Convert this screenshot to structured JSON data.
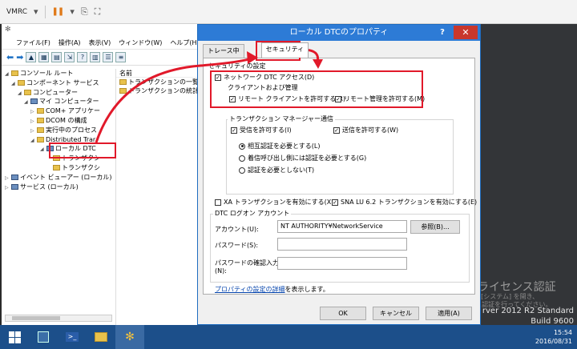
{
  "vmrc": {
    "title": "VMRC"
  },
  "component_services": {
    "menu": [
      "ファイル(F)",
      "操作(A)",
      "表示(V)",
      "ウィンドウ(W)",
      "ヘルプ(H)"
    ],
    "tree": [
      "コンソール ルート",
      "コンポーネント サービス",
      "コンピューター",
      "マイ コンピューター",
      "COM+ アプリケー",
      "DCOM の構成",
      "実行中のプロセス",
      "Distributed Trar",
      "ローカル DTC",
      "トランザクシ",
      "トランザクシ",
      "イベント ビューアー (ローカル)",
      "サービス (ローカル)"
    ],
    "list_header": "名前",
    "list_items": [
      "トランザクションの一覧",
      "トランザクションの統計"
    ]
  },
  "dialog": {
    "title": "ローカル DTCのプロパティ",
    "help_label": "?",
    "close_label": "✕",
    "tabs": [
      "トレース中",
      "セキュリティ"
    ],
    "security_settings_label": "セキュリティの設定",
    "network_dtc_access": "ネットワーク DTC アクセス(D)",
    "client_admin_label": "クライアントおよび管理",
    "allow_remote_clients": "リモート クライアントを許可する(R)",
    "allow_remote_admin": "リモート管理を許可する(M)",
    "tm_comm_label": "トランザクション マネージャー通信",
    "allow_inbound": "受信を許可する(I)",
    "allow_outbound": "送信を許可する(W)",
    "auth_mutual": "相互認証を必要とする(L)",
    "auth_incoming": "着信呼び出し側には認証を必要とする(G)",
    "auth_none": "認証を必要としない(T)",
    "xa_enable": "XA トランザクションを有効にする(X)",
    "sna_enable": "SNA LU 6.2 トランザクションを有効にする(E)",
    "logon_label": "DTC ログオン アカウント",
    "account_label": "アカウント(U):",
    "account_value": "NT AUTHORITY¥NetworkService",
    "browse_label": "参照(B)...",
    "password_label": "パスワード(S):",
    "confirm_label": "パスワードの確認入力(N):",
    "link_text": "プロパティの設定の詳細",
    "link_suffix": "を表示します。",
    "ok": "OK",
    "cancel": "キャンセル",
    "apply": "適用(A)"
  },
  "desktop": {
    "wm_line1": "Windows のライセンス認証",
    "wm_line2": "コントロール パネルの [システム] を開き、",
    "wm_line3": "Windows のライセンス認証を行ってください。",
    "os_name": "rver 2012 R2 Standard",
    "build": "Build 9600"
  },
  "taskbar": {
    "time": "15:54",
    "date": "2016/08/31"
  },
  "colors": {
    "accent": "#2d7bd6",
    "highlight": "#e1192a",
    "taskbar": "#1c4f8a"
  }
}
